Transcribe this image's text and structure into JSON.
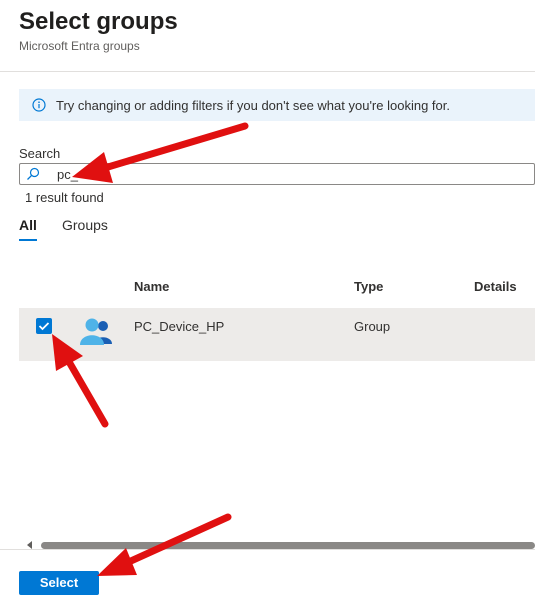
{
  "header": {
    "title": "Select groups",
    "subtitle": "Microsoft Entra groups"
  },
  "info_bar": {
    "icon": "info-icon",
    "text": "Try changing or adding filters if you don't see what you're looking for."
  },
  "search": {
    "label": "Search",
    "value": "pc_",
    "icon": "search-icon",
    "result_count": "1 result found"
  },
  "tabs": [
    {
      "label": "All",
      "selected": true
    },
    {
      "label": "Groups",
      "selected": false
    }
  ],
  "table": {
    "columns": [
      "Name",
      "Type",
      "Details"
    ],
    "rows": [
      {
        "checked": true,
        "icon": "group-icon",
        "name": "PC_Device_HP",
        "type": "Group",
        "details": ""
      }
    ]
  },
  "footer": {
    "select_label": "Select"
  },
  "colors": {
    "accent": "#0078d4",
    "annotation_arrow": "#e01010",
    "selected_row": "#edebe9",
    "info_bar_bg": "#eaf3fb"
  }
}
